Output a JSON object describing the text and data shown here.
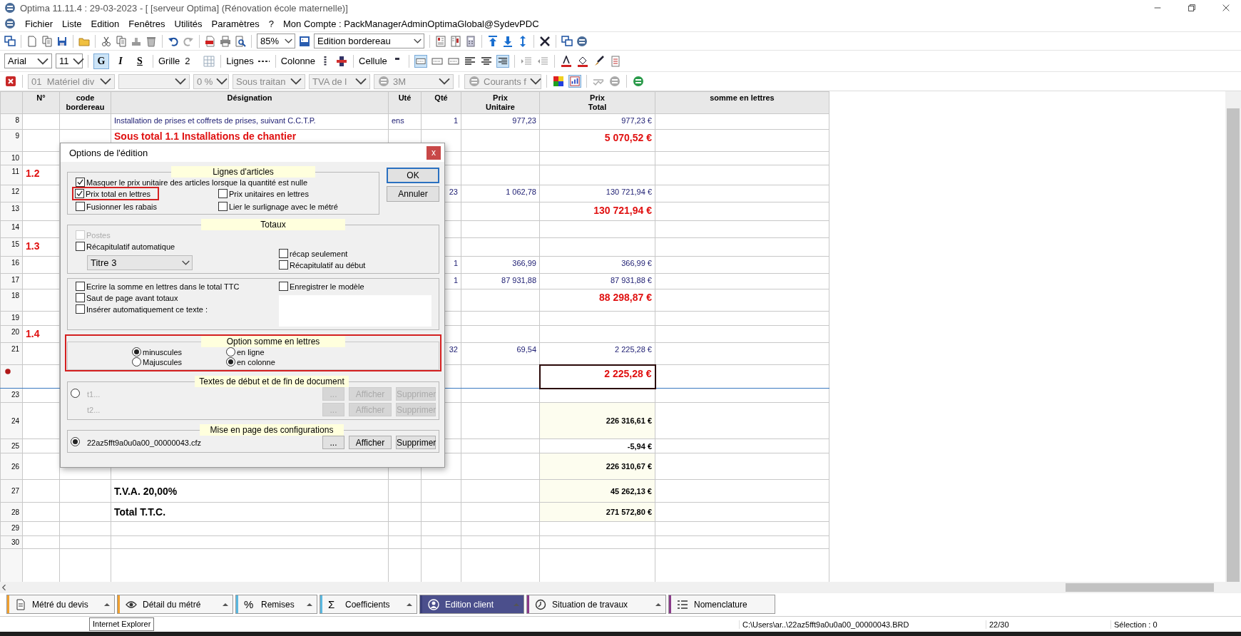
{
  "window": {
    "title": "Optima 11.11.4 : 29-03-2023 - [ [serveur Optima] (Rénovation école maternelle)]"
  },
  "menu": [
    "Fichier",
    "Liste",
    "Edition",
    "Fenêtres",
    "Utilités",
    "Paramètres",
    "?",
    "Mon Compte : PackManagerAdminOptimaGlobal@SydevPDC"
  ],
  "toolbar_main": {
    "zoom": "85%",
    "view": "Edition bordereau"
  },
  "toolbar_format": {
    "font": "Arial",
    "size": "11",
    "styles": [
      {
        "label": "G",
        "pressed": true
      },
      {
        "label": "I",
        "pressed": false
      },
      {
        "label": "S",
        "pressed": false
      }
    ],
    "grid_label": "Grille",
    "grid_value": "2",
    "lines_label": "Lignes",
    "columns_label": "Colonne",
    "cell_label": "Cellule",
    "border_buttons": [
      {
        "pressed": true
      },
      {
        "pressed": false
      },
      {
        "pressed": false
      }
    ],
    "align_buttons": [
      {
        "pressed": false
      },
      {
        "pressed": false
      },
      {
        "pressed": true
      }
    ]
  },
  "toolbar_article": {
    "combos": [
      {
        "value": "01  Matériel div",
        "disabled": true
      },
      {
        "disabled": true
      },
      {
        "value": "0 %",
        "disabled": true
      },
      {
        "value": "Sous traitan",
        "disabled": true
      },
      {
        "value": "TVA de l",
        "disabled": true
      },
      {
        "value": "3M",
        "disabled": true
      },
      {
        "value": "Courants f",
        "disabled": true
      }
    ],
    "view_buttons": [
      {
        "pressed": false
      },
      {
        "pressed": true
      }
    ]
  },
  "table": {
    "columns": [
      "N°",
      "code\nbordereau",
      "Désignation",
      "Uté",
      "Qté",
      "Prix\nUnitaire",
      "Prix\nTotal",
      "somme en lettres"
    ],
    "rows": [
      {
        "number": "8",
        "kind": "item",
        "designation": "Installation de prises et coffrets de prises, suivant C.C.T.P.",
        "unit": "ens",
        "qty": "1",
        "unit_price": "977,23",
        "total": "977,23 €",
        "current": false,
        "shaded": false
      },
      {
        "number": "9",
        "kind": "subtotal",
        "designation": "Sous total 1.1 Installations de chantier",
        "total": "5 070,52 €",
        "current": false,
        "shaded": false
      },
      {
        "number": "10",
        "kind": "blank",
        "current": false,
        "shaded": false
      },
      {
        "number": "11",
        "kind": "section",
        "code": "1.2",
        "current": false,
        "shaded": false
      },
      {
        "number": "12",
        "kind": "item",
        "qty": "23",
        "unit_price": "1 062,78",
        "total": "130 721,94 €",
        "current": false,
        "shaded": false
      },
      {
        "number": "13",
        "kind": "subtotal",
        "total": "130 721,94 €",
        "current": false,
        "shaded": false
      },
      {
        "number": "14",
        "kind": "blank",
        "current": false,
        "shaded": false
      },
      {
        "number": "15",
        "kind": "section",
        "code": "1.3",
        "current": false,
        "shaded": false
      },
      {
        "number": "16",
        "kind": "item",
        "qty": "1",
        "unit_price": "366,99",
        "total": "366,99 €",
        "current": false,
        "shaded": false
      },
      {
        "number": "17",
        "kind": "item",
        "qty": "1",
        "unit_price": "87 931,88",
        "total": "87 931,88 €",
        "current": false,
        "shaded": false
      },
      {
        "number": "18",
        "kind": "subtotal",
        "total": "88 298,87 €",
        "current": false,
        "shaded": false
      },
      {
        "number": "19",
        "kind": "blank",
        "current": false,
        "shaded": false
      },
      {
        "number": "20",
        "kind": "section",
        "code": "1.4",
        "current": false,
        "shaded": false
      },
      {
        "number": "21",
        "kind": "item",
        "qty": "32",
        "unit_price": "69,54",
        "total": "2 225,28 €",
        "current": false,
        "shaded": false
      },
      {
        "kind": "subtotal",
        "total": "2 225,28 €",
        "current": true,
        "shaded": false
      },
      {
        "number": "23",
        "kind": "blank",
        "current": false,
        "shaded": false
      },
      {
        "number": "24",
        "kind": "total",
        "total": "226 316,61 €",
        "current": false,
        "shaded": true
      },
      {
        "number": "25",
        "kind": "total",
        "total": "-5,94 €",
        "current": false,
        "shaded": false
      },
      {
        "number": "26",
        "kind": "total",
        "total": "226 310,67 €",
        "current": false,
        "shaded": true
      },
      {
        "number": "27",
        "kind": "total",
        "designation": "T.V.A. 20,00%",
        "total": "45 262,13 €",
        "current": false,
        "shaded": true
      },
      {
        "number": "28",
        "kind": "total",
        "designation": "Total  T.T.C.",
        "total": "271 572,80 €",
        "current": false,
        "shaded": true
      },
      {
        "number": "29",
        "kind": "blank",
        "current": false,
        "shaded": false
      },
      {
        "number": "30",
        "kind": "blank",
        "current": false,
        "shaded": false
      }
    ]
  },
  "dialog": {
    "title": "Options de l'édition",
    "close_label": "x",
    "buttons": [
      {
        "label": "OK",
        "default": true
      },
      {
        "label": "Annuler",
        "default": false
      }
    ],
    "articles": {
      "legend": "Lignes d'articles",
      "options": [
        {
          "label": "Masquer le prix unitaire des articles lorsque la quantité est nulle",
          "checked": true,
          "highlighted": false
        },
        {
          "label": "Prix total en lettres",
          "checked": true,
          "highlighted": true
        },
        {
          "label": "Prix unitaires en lettres",
          "checked": false,
          "highlighted": false
        },
        {
          "label": "Fusionner les rabais",
          "checked": false,
          "highlighted": false
        },
        {
          "label": "Lier le surlignage avec le métré",
          "checked": false,
          "highlighted": false
        }
      ]
    },
    "totals": {
      "legend": "Totaux",
      "left": [
        {
          "label": "Postes",
          "checked": false,
          "disabled": true
        },
        {
          "label": "Récapitulatif automatique",
          "checked": false,
          "disabled": false
        }
      ],
      "level": "Titre 3",
      "right": [
        {
          "label": "récap seulement",
          "checked": false,
          "disabled": false
        },
        {
          "label": "Récapitulatif au début",
          "checked": false,
          "disabled": false
        }
      ]
    },
    "text_options": {
      "left": [
        {
          "label": "Ecrire la somme en lettres dans le total TTC",
          "checked": false
        },
        {
          "label": "Saut de page avant totaux",
          "checked": false
        },
        {
          "label": "Insérer automatiquement ce texte :",
          "checked": false
        }
      ],
      "right": [
        {
          "label": "Enregistrer le modèle",
          "checked": false
        }
      ]
    },
    "words": {
      "legend": "Option somme en lettres",
      "case_options": [
        {
          "label": "minuscules",
          "selected": true
        },
        {
          "label": "Majuscules",
          "selected": false
        }
      ],
      "layout_options": [
        {
          "label": "en ligne",
          "selected": false
        },
        {
          "label": "en colonne",
          "selected": true
        }
      ]
    },
    "sources": [
      {
        "legend": "Textes de début et de fin de document",
        "selected": false,
        "disabled": true,
        "lines": [
          {
            "label": "t1...",
            "buttons": [
              "...",
              "Afficher",
              "Supprimer"
            ]
          },
          {
            "label": "t2...",
            "buttons": [
              "...",
              "Afficher",
              "Supprimer"
            ]
          }
        ]
      },
      {
        "legend": "Mise en page des configurations",
        "selected": true,
        "disabled": false,
        "lines": [
          {
            "label": "22az5fft9a0u0a00_00000043.cfz",
            "buttons": [
              "...",
              "Afficher",
              "Supprimer"
            ]
          }
        ]
      }
    ]
  },
  "tabs": [
    {
      "label": "Métré du devis",
      "color": "#f0a030",
      "selected": false,
      "menu": true
    },
    {
      "label": "Détail du métré",
      "color": "#f0a030",
      "selected": false,
      "menu": true
    },
    {
      "label": "Remises",
      "symbol": "%",
      "color": "#5bb8e0",
      "selected": false,
      "menu": true
    },
    {
      "label": "Coefficients",
      "symbol": "Σ",
      "color": "#5bb8e0",
      "selected": false,
      "menu": true
    },
    {
      "label": "Edition client",
      "color": "#3a3f7a",
      "selected": true,
      "menu": true
    },
    {
      "label": "Situation de travaux",
      "color": "#8a3a8a",
      "selected": false,
      "menu": true
    },
    {
      "label": "Nomenclature",
      "color": "#8a3a8a",
      "selected": false,
      "menu": false
    }
  ],
  "tooltip": "Internet Explorer",
  "status_bar": {
    "path": "C:\\Users\\ar..\\22az5fft9a0u0a00_00000043.BRD",
    "position": "22/30",
    "selection": "Sélection : 0"
  }
}
